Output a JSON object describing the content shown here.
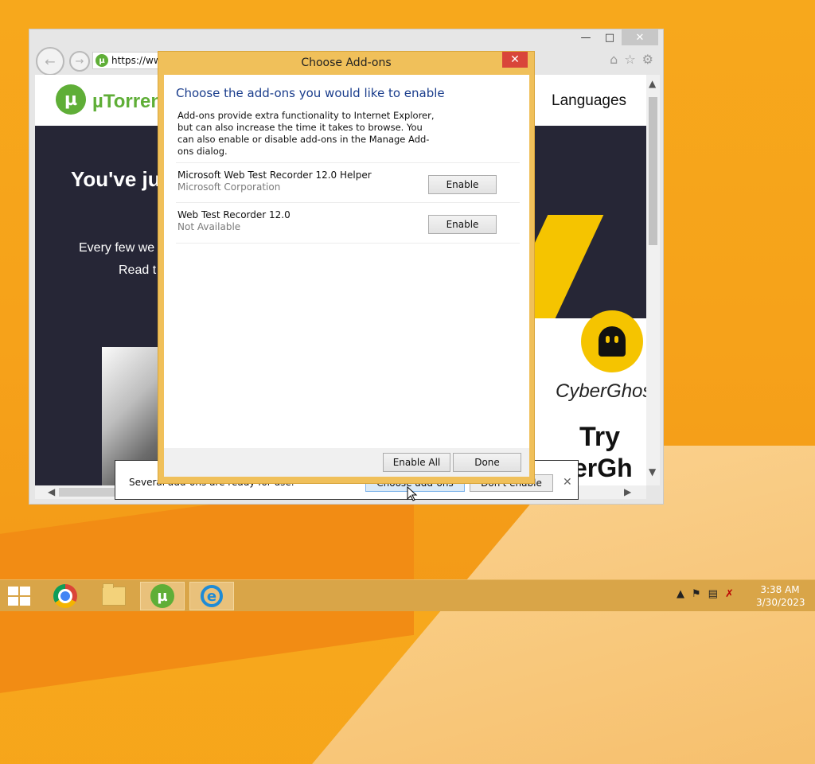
{
  "browser": {
    "address_text": "https://ww",
    "site": {
      "brand_name": "µTorrent",
      "nav_languages": "Languages",
      "hero_title": "You've ju",
      "hero_line1": "Every few we",
      "hero_line2": "Read t",
      "ad_brand": "CyberGhos",
      "ad_try": "Try",
      "ad_tail": "erGh"
    }
  },
  "notification": {
    "text": "Several add-ons are ready for use.",
    "choose_label": "Choose add-ons",
    "dont_enable_label": "Don't enable"
  },
  "dialog": {
    "title": "Choose Add-ons",
    "heading": "Choose the add-ons you would like to enable",
    "description": "Add-ons provide extra functionality to Internet Explorer, but can also increase the time it takes to browse. You can also enable or disable add-ons in the Manage Add-ons dialog.",
    "addons": [
      {
        "name": "Microsoft Web Test Recorder 12.0 Helper",
        "publisher": "Microsoft Corporation",
        "button": "Enable"
      },
      {
        "name": "Web Test Recorder 12.0",
        "publisher": "Not Available",
        "button": "Enable"
      }
    ],
    "enable_all_label": "Enable All",
    "done_label": "Done"
  },
  "taskbar": {
    "clock_time": "3:38 AM",
    "clock_date": "3/30/2023",
    "accent_color": "#d9a548"
  }
}
